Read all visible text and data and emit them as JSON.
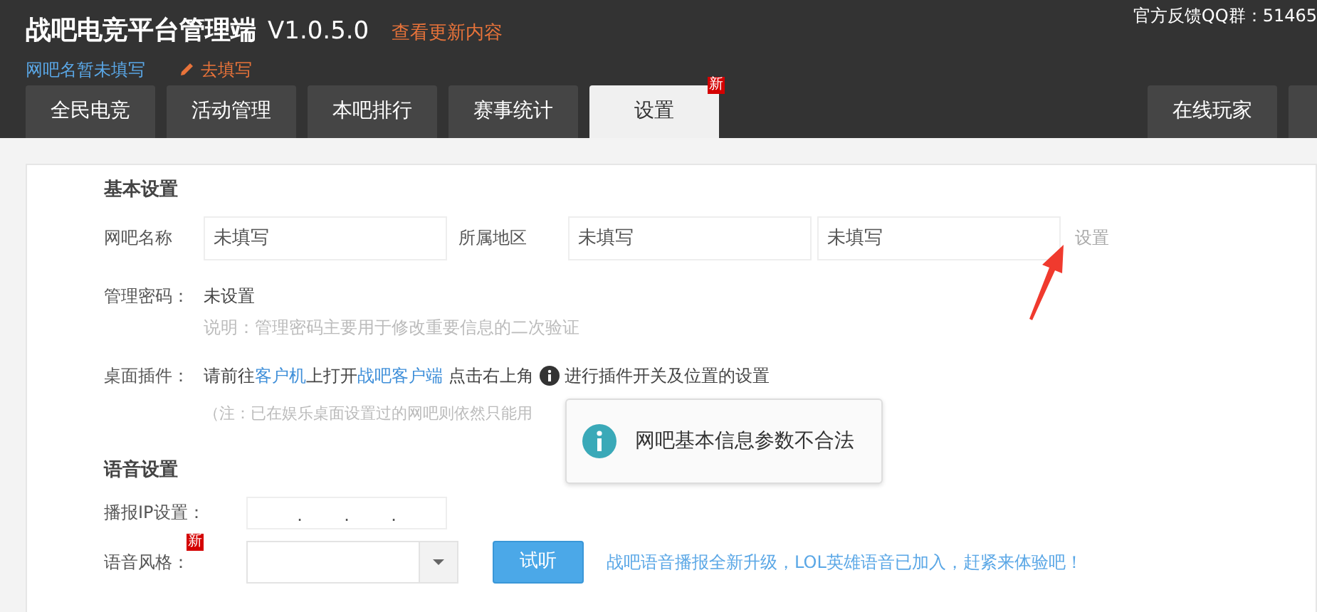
{
  "header": {
    "title": "战吧电竞平台管理端",
    "version": "V1.0.5.0",
    "update_link": "查看更新内容",
    "netbar_name": "网吧名暂未填写",
    "edit_link": "去填写",
    "feedback": "官方反馈QQ群：51465"
  },
  "tabs": [
    {
      "label": "全民电竞",
      "selected": false
    },
    {
      "label": "活动管理",
      "selected": false
    },
    {
      "label": "本吧排行",
      "selected": false
    },
    {
      "label": "赛事统计",
      "selected": false
    },
    {
      "label": "设置",
      "selected": true,
      "badge": "新"
    }
  ],
  "right_tabs": [
    {
      "label": "在线玩家",
      "selected": false
    }
  ],
  "basic": {
    "heading": "基本设置",
    "name_label": "网吧名称",
    "name_value": "未填写",
    "region_label": "所属地区",
    "region_values": [
      "未填写",
      "未填写"
    ],
    "set_button": {
      "label": "设置",
      "disabled": true
    },
    "password_label": "管理密码：",
    "password_value": "未设置",
    "password_hint": "说明：管理密码主要用于修改重要信息的二次验证",
    "plugin_label": "桌面插件：",
    "plugin_parts": [
      {
        "kind": "text",
        "text": "请前往"
      },
      {
        "kind": "link",
        "text": "客户机"
      },
      {
        "kind": "text",
        "text": "上打开"
      },
      {
        "kind": "link",
        "text": "战吧客户端"
      },
      {
        "kind": "text",
        "text": " 点击右上角 "
      },
      {
        "kind": "icon"
      },
      {
        "kind": "text",
        "text": " 进行插件开关及位置的设置"
      }
    ],
    "plugin_note": "（注：已在娱乐桌面设置过的网吧则依然只能用"
  },
  "voice": {
    "heading": "语音设置",
    "ip_label": "播报IP设置：",
    "ip_dots": [
      ".",
      ".",
      "."
    ],
    "style_label": "语音风格：",
    "style_badge": "新",
    "listen_button": "试听",
    "promo": "战吧语音播报全新升级，LOL英雄语音已加入，赶紧来体验吧！"
  },
  "toast": {
    "text": "网吧基本信息参数不合法"
  }
}
